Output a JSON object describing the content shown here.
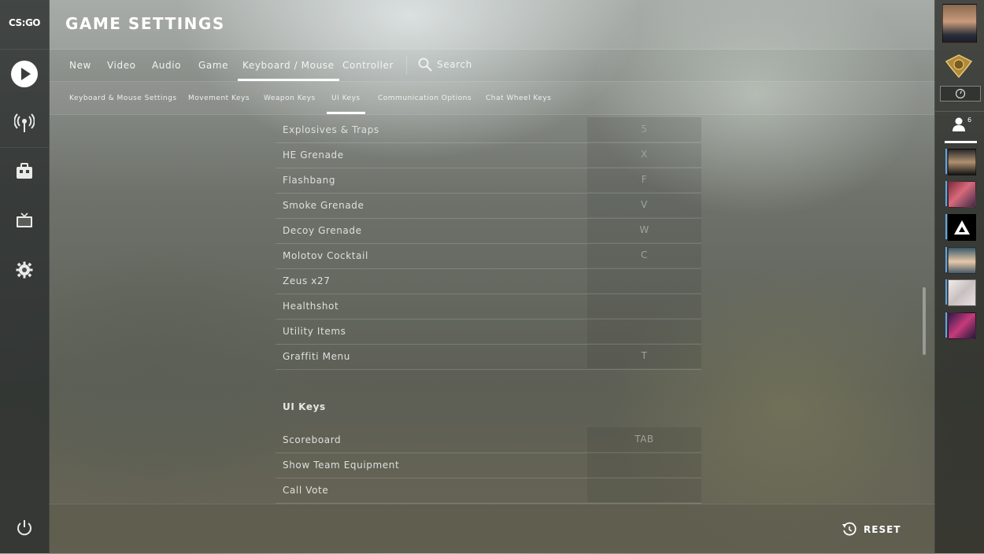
{
  "logo": {
    "text": "CS:GO"
  },
  "header": {
    "title": "GAME SETTINGS"
  },
  "tabs": [
    {
      "label": "New"
    },
    {
      "label": "Video"
    },
    {
      "label": "Audio"
    },
    {
      "label": "Game"
    },
    {
      "label": "Keyboard / Mouse",
      "active": true
    },
    {
      "label": "Controller"
    }
  ],
  "search": {
    "label": "Search"
  },
  "subtabs": [
    {
      "label": "Keyboard & Mouse Settings"
    },
    {
      "label": "Movement Keys"
    },
    {
      "label": "Weapon Keys"
    },
    {
      "label": "UI Keys",
      "active": true
    },
    {
      "label": "Communication Options"
    },
    {
      "label": "Chat Wheel Keys"
    }
  ],
  "weapon_rows": [
    {
      "label": "Explosives & Traps",
      "key": "5"
    },
    {
      "label": "HE Grenade",
      "key": "X"
    },
    {
      "label": "Flashbang",
      "key": "F"
    },
    {
      "label": "Smoke Grenade",
      "key": "V"
    },
    {
      "label": "Decoy Grenade",
      "key": "W"
    },
    {
      "label": "Molotov Cocktail",
      "key": "C"
    },
    {
      "label": "Zeus x27",
      "key": ""
    },
    {
      "label": "Healthshot",
      "key": ""
    },
    {
      "label": "Utility Items",
      "key": ""
    },
    {
      "label": "Graffiti Menu",
      "key": "T"
    }
  ],
  "ui_section": {
    "title": "UI Keys"
  },
  "ui_rows": [
    {
      "label": "Scoreboard",
      "key": "TAB"
    },
    {
      "label": "Show Team Equipment",
      "key": ""
    },
    {
      "label": "Call Vote",
      "key": ""
    }
  ],
  "footer": {
    "reset_label": "RESET"
  },
  "friends": {
    "count": "6"
  },
  "colors": {
    "accent": "#ffffff",
    "friend_online": "#5fa6e8"
  }
}
